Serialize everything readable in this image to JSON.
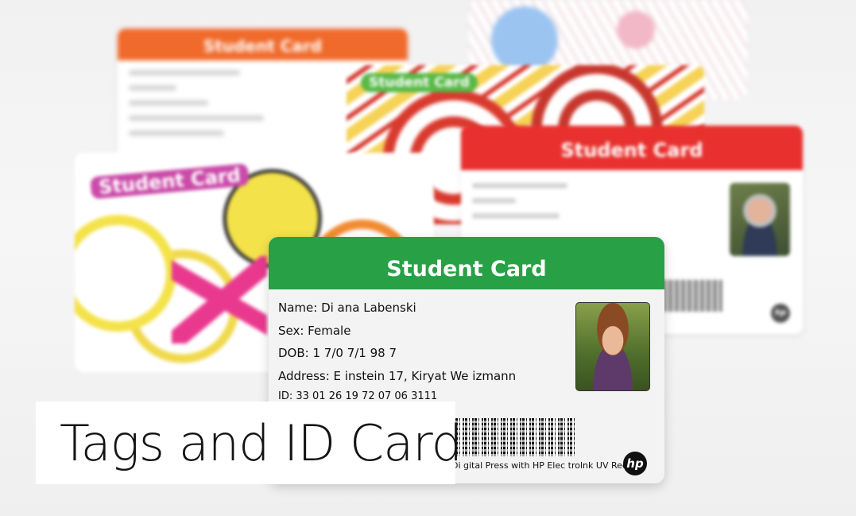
{
  "caption": "Tags and ID Card",
  "cards": {
    "back_orange": {
      "title": "Student Card",
      "color": "#f06a2b"
    },
    "swirl": {
      "title": "Student Card",
      "color": "#57b947"
    },
    "right_red": {
      "title": "Student Card",
      "color": "#e8312e"
    },
    "left_doodle": {
      "title": "Student Card",
      "color": "#ca4aa8"
    },
    "front_green": {
      "title": "Student Card",
      "color": "#27a046",
      "name": "Name: Di ana  Labenski",
      "sex": "Sex:  Female",
      "dob": "DOB: 1  7/0  7/1  98 7",
      "address": "Address: E instein  17,  Kiryat  We izmann",
      "id": "ID:  33 01 26 19 72 07 06 3111",
      "footer": "Di gital Press with HP Elec trolnk UV  Red",
      "logo": "hp"
    }
  }
}
